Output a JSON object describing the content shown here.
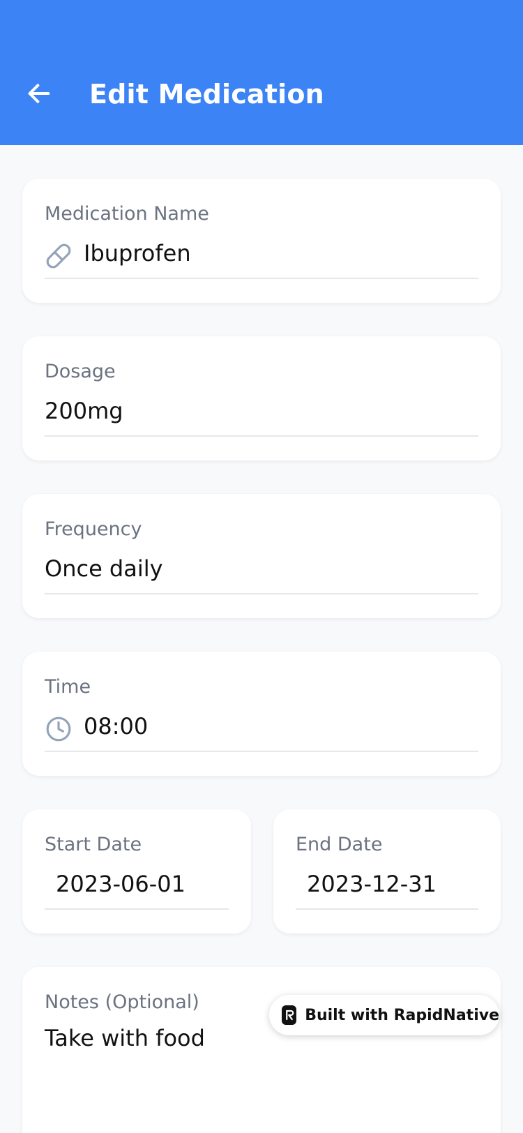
{
  "header": {
    "title": "Edit Medication",
    "back_icon": "arrow-left-icon",
    "background": "#3C83F6"
  },
  "fields": {
    "name": {
      "label": "Medication Name",
      "value": "Ibuprofen",
      "icon": "pill-icon"
    },
    "dosage": {
      "label": "Dosage",
      "value": "200mg"
    },
    "frequency": {
      "label": "Frequency",
      "value": "Once daily"
    },
    "time": {
      "label": "Time",
      "value": "08:00",
      "icon": "clock-icon"
    },
    "start_date": {
      "label": "Start Date",
      "value": "2023-06-01"
    },
    "end_date": {
      "label": "End Date",
      "value": "2023-12-31"
    },
    "notes": {
      "label": "Notes (Optional)",
      "value": "Take with food"
    }
  },
  "badge": {
    "label": "Built with RapidNative",
    "icon": "rapidnative-logo-icon"
  }
}
